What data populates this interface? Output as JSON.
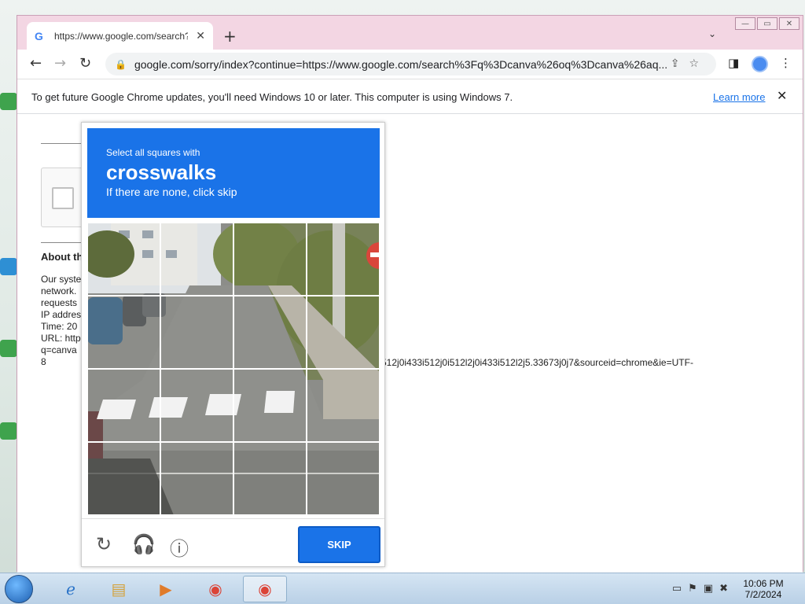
{
  "browser": {
    "tab_title": "https://www.google.com/search?q",
    "tab_close": "✕",
    "new_tab": "+",
    "tab_menu": "⌄",
    "back": "←",
    "forward": "→",
    "reload": "↻",
    "url": "google.com/sorry/index?continue=https://www.google.com/search%3Fq%3Dcanva%26oq%3Dcanva%26aq...",
    "window_controls": [
      "—",
      "▭",
      "✕"
    ]
  },
  "infobar": {
    "message": "To get future Google Chrome updates, you'll need Windows 10 or later. This computer is using Windows 7.",
    "learn_more": "Learn more",
    "close": "✕"
  },
  "page": {
    "about_heading": "About th",
    "para": [
      "Our syste",
      "network.",
      "requests",
      "",
      "IP addres",
      "Time: 20",
      "URL: http",
      "q=canva",
      "8"
    ],
    "url_fragment": "512j0i433i512j0i512l2j0i433i512l2j5.33673j0j7&sourceid=chrome&ie=UTF-"
  },
  "captcha": {
    "line1": "Select all squares with",
    "target": "crosswalks",
    "line3": "If there are none, click skip",
    "grid_size": 4,
    "skip_label": "SKIP",
    "colors": {
      "header": "#1a73e8",
      "skip": "#1a73e8"
    }
  },
  "taskbar": {
    "items": [
      "internet-explorer",
      "file-explorer",
      "media-player",
      "chrome",
      "chrome-active"
    ],
    "time": "10:06 PM",
    "date": "7/2/2024"
  }
}
